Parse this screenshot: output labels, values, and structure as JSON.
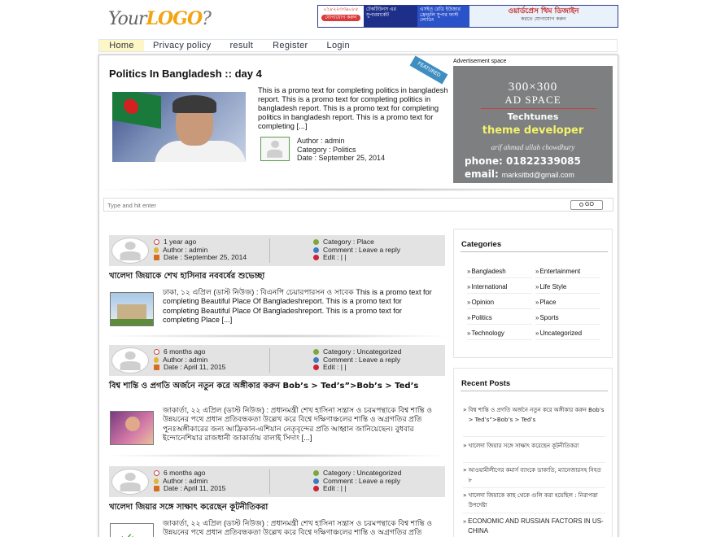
{
  "header": {
    "logo": {
      "your": "Your",
      "logo": "LOGO",
      "mark": "?"
    },
    "banner": {
      "col1_line": "০১৮২২৩৩৯০৮৫",
      "col1_pill": "যোগাযোগ করুন",
      "col2": "টেকটিউনস এর সুপারমার্কেট",
      "col3": "এসইও রেডি ইউজার ফ্রেন্ডলি সুপার ফাস্ট লোডিং",
      "col4_title": "ওয়ার্ডপ্রেস থিম ডিজাইন",
      "col4_sub": "করতে যোগাযোগ করুন"
    }
  },
  "nav": {
    "items": [
      "Home",
      "Privacy policy",
      "result",
      "Register",
      "Login"
    ]
  },
  "featured": {
    "title": "Politics In Bangladesh :: day 4",
    "ribbon": "FEATURED",
    "excerpt": "This is a promo text for completing politics in bangladesh report. This is a promo text for completing politics in bangladesh report. This is a promo text for completing politics in bangladesh report. This is a promo text for completing [...]",
    "author": "Author : admin",
    "category": "Category : Politics",
    "date": "Date : September 25, 2014"
  },
  "ad": {
    "label": "Advertisement space",
    "size": "300×300",
    "space": "AD SPACE",
    "brand": "Techtunes",
    "role": "theme developer",
    "name": "arif ahmad ullah chowdhury",
    "phone": "phone: 01822339085",
    "email_label": "email:",
    "email": "marksitbd@gmail.com"
  },
  "search": {
    "placeholder": "Type and hit enter",
    "button": "GO"
  },
  "posts": [
    {
      "time": "1 year ago",
      "author": "Author : admin",
      "date": "Date : September 25, 2014",
      "category": "Category : Place",
      "comment": "Comment : Leave a reply",
      "edit": "Edit : | |",
      "title": "খালেদা জিয়াকে শেখ হাসিনার নববর্ষের শুভেচ্ছা",
      "excerpt": "ঢাকা, ১২ এপ্রিল (ডাস্ট নিউজ) : বিএনপি চেয়ারপারসন ও সাবেক  This is a promo text for completing Beautiful Place Of Bangladeshreport. This is a promo text for completing Beautiful Place Of Bangladeshreport. This is a promo text for completing  Place [...]"
    },
    {
      "time": "6 months ago",
      "author": "Author : admin",
      "date": "Date : April 11, 2015",
      "category": "Category : Uncategorized",
      "comment": "Comment : Leave a reply",
      "edit": "Edit : | |",
      "title": "বিশ্ব শান্তি ও প্রগতি অর্জনে নতুন করে অঙ্গীকার করুন Bob’s > Ted’s”>Bob’s > Ted’s",
      "excerpt": "জাকার্তা, ২২ এপ্রিল (ডাস্ট নিউজ) : প্রধানমন্ত্রী শেখ হাসিনা সন্ত্রাস ও চরমপন্থাকে বিশ্ব শান্তি ও উন্নয়নের পথে প্রধান প্রতিবন্ধকতা উল্লেখ করে বিশ্বে দক্ষিণাঞ্চলের শান্তি ও অগ্রগতির প্রতি পুনঃঅঙ্গীকারের জন্য আফ্রিকান-এশিয়ান নেতৃবৃন্দের প্রতি আহ্বান জানিয়েছেন। বুধবার ইন্দোনেশিয়ার রাজধানী জাকার্তায় বালাই সিদাং [...]"
    },
    {
      "time": "6 months ago",
      "author": "Author : admin",
      "date": "Date : April 11, 2015",
      "category": "Category : Uncategorized",
      "comment": "Comment : Leave a reply",
      "edit": "Edit : | |",
      "title": "খালেদা জিয়ার সঙ্গে সাক্ষাৎ করেছেন কূটনীতিকরা",
      "excerpt": "জাকার্তা, ২২ এপ্রিল (ডাস্ট নিউজ) : প্রধানমন্ত্রী শেখ হাসিনা সন্ত্রাস ও চরমপন্থাকে বিশ্ব শান্তি ও উন্নয়নের পথে প্রধান প্রতিবন্ধকতা উল্লেখ করে বিশ্বে দক্ষিণাঞ্চলের শান্তি ও অগ্রগতির প্রতি"
    }
  ],
  "sidebar": {
    "categories": {
      "title": "Categories",
      "left": [
        "Bangladesh",
        "International",
        "Opinion",
        "Politics",
        "Technology"
      ],
      "right": [
        "Entertainment",
        "Life Style",
        "Place",
        "Sports",
        "Uncategorized"
      ]
    },
    "recent": {
      "title": "Recent Posts",
      "items": [
        "বিশ্ব শান্তি ও প্রগতি অর্জনে নতুন করে অঙ্গীকার করুন Bob’s > Ted’s”>Bob’s > Ted’s",
        "খালেদা জিয়ার সঙ্গে সাক্ষাৎ করেছেন কূটনীতিকরা",
        "আওয়ামীলীগের কমার্স ব্যাংকে ডাকাতি, ম্যানেজারসহ নিহত ৮",
        "খালেদা জিয়াকে কাছ থেকে গুলি করা হয়েছিল : নিরাপত্তা উপদেষ্টা",
        "ECONOMIC AND RUSSIAN FACTORS IN US-CHINA"
      ]
    }
  }
}
